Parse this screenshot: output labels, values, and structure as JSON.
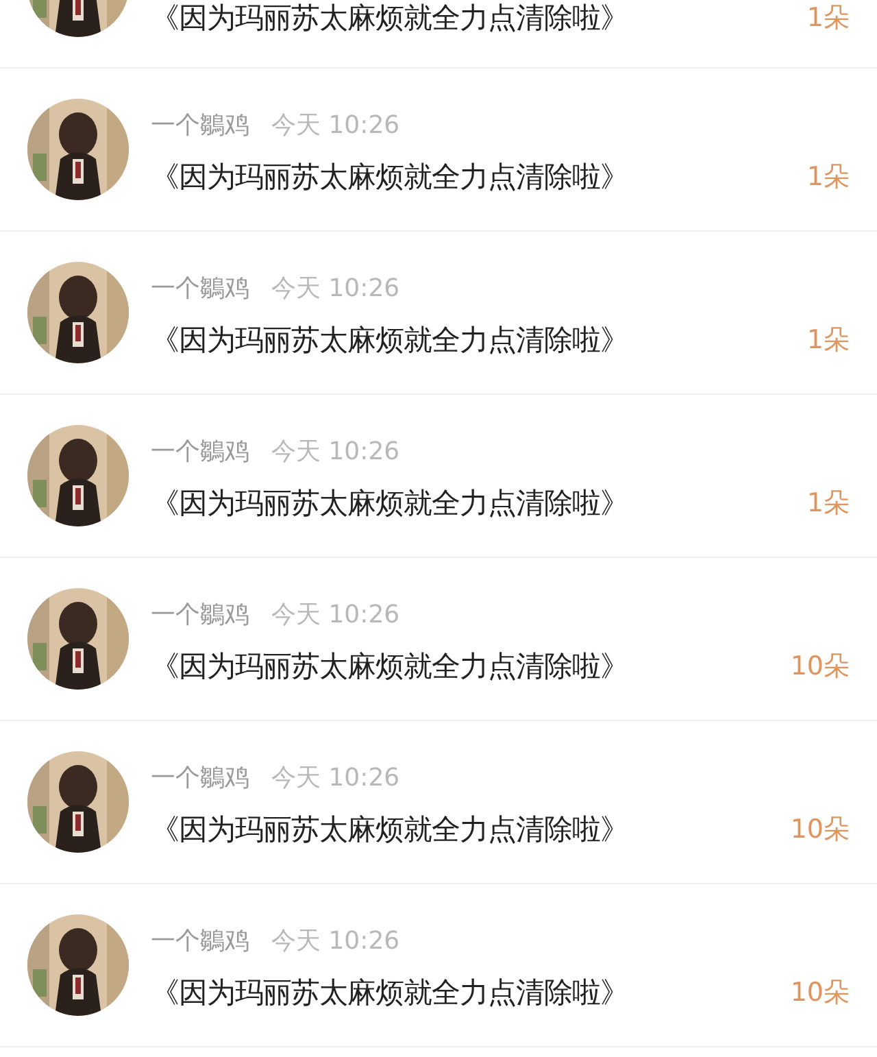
{
  "comments": [
    {
      "title": "《因为玛丽苏太麻烦就全力点清除啦》",
      "count": "1朵"
    },
    {
      "name": "一个鶵鸡",
      "time": "今天 10:26",
      "title": "《因为玛丽苏太麻烦就全力点清除啦》",
      "count": "1朵"
    },
    {
      "name": "一个鶵鸡",
      "time": "今天 10:26",
      "title": "《因为玛丽苏太麻烦就全力点清除啦》",
      "count": "1朵"
    },
    {
      "name": "一个鶵鸡",
      "time": "今天 10:26",
      "title": "《因为玛丽苏太麻烦就全力点清除啦》",
      "count": "1朵"
    },
    {
      "name": "一个鶵鸡",
      "time": "今天 10:26",
      "title": "《因为玛丽苏太麻烦就全力点清除啦》",
      "count": "10朵"
    },
    {
      "name": "一个鶵鸡",
      "time": "今天 10:26",
      "title": "《因为玛丽苏太麻烦就全力点清除啦》",
      "count": "10朵"
    },
    {
      "name": "一个鶵鸡",
      "time": "今天 10:26",
      "title": "《因为玛丽苏太麻烦就全力点清除啦》",
      "count": "10朵"
    }
  ]
}
